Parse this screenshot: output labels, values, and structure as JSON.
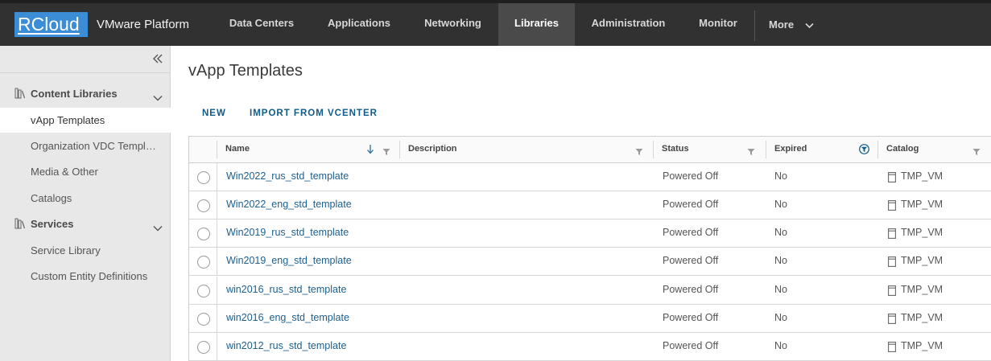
{
  "header": {
    "logo_text": "RCloud",
    "app_name": "VMware Platform",
    "nav": [
      {
        "label": "Data Centers",
        "active": false
      },
      {
        "label": "Applications",
        "active": false
      },
      {
        "label": "Networking",
        "active": false
      },
      {
        "label": "Libraries",
        "active": true
      },
      {
        "label": "Administration",
        "active": false
      },
      {
        "label": "Monitor",
        "active": false
      }
    ],
    "more_label": "More"
  },
  "sidebar": {
    "collapse_icon": "double-chevron-left-icon",
    "groups": [
      {
        "label": "Content Libraries",
        "icon": "library-icon",
        "items": [
          {
            "label": "vApp Templates",
            "active": true
          },
          {
            "label": "Organization VDC Templates",
            "active": false
          },
          {
            "label": "Media & Other",
            "active": false
          },
          {
            "label": "Catalogs",
            "active": false
          }
        ]
      },
      {
        "label": "Services",
        "icon": "library-icon",
        "items": [
          {
            "label": "Service Library",
            "active": false
          },
          {
            "label": "Custom Entity Definitions",
            "active": false
          }
        ]
      }
    ]
  },
  "main": {
    "title": "vApp Templates",
    "actions": [
      "NEW",
      "IMPORT FROM VCENTER"
    ],
    "grid": {
      "columns": [
        "Name",
        "Description",
        "Status",
        "Expired",
        "Catalog"
      ],
      "sorted_column": "Name",
      "active_filter_column": "Expired",
      "rows": [
        {
          "name": "Win2022_rus_std_template",
          "description": "",
          "status": "Powered Off",
          "expired": "No",
          "catalog": "TMP_VM"
        },
        {
          "name": "Win2022_eng_std_template",
          "description": "",
          "status": "Powered Off",
          "expired": "No",
          "catalog": "TMP_VM"
        },
        {
          "name": "Win2019_rus_std_template",
          "description": "",
          "status": "Powered Off",
          "expired": "No",
          "catalog": "TMP_VM"
        },
        {
          "name": "Win2019_eng_std_template",
          "description": "",
          "status": "Powered Off",
          "expired": "No",
          "catalog": "TMP_VM"
        },
        {
          "name": "win2016_rus_std_template",
          "description": "",
          "status": "Powered Off",
          "expired": "No",
          "catalog": "TMP_VM"
        },
        {
          "name": "win2016_eng_std_template",
          "description": "",
          "status": "Powered Off",
          "expired": "No",
          "catalog": "TMP_VM"
        },
        {
          "name": "win2012_rus_std_template",
          "description": "",
          "status": "Powered Off",
          "expired": "No",
          "catalog": "TMP_VM"
        }
      ]
    }
  },
  "colors": {
    "header_bg": "#313131",
    "active_nav_bg": "#4a4a4a",
    "logo_bg": "#3b8ed6",
    "sidebar_bg": "#e8e8e8",
    "link": "#1d5f8e",
    "action": "#0f5c8a",
    "filter_active": "#0f5c8a"
  }
}
